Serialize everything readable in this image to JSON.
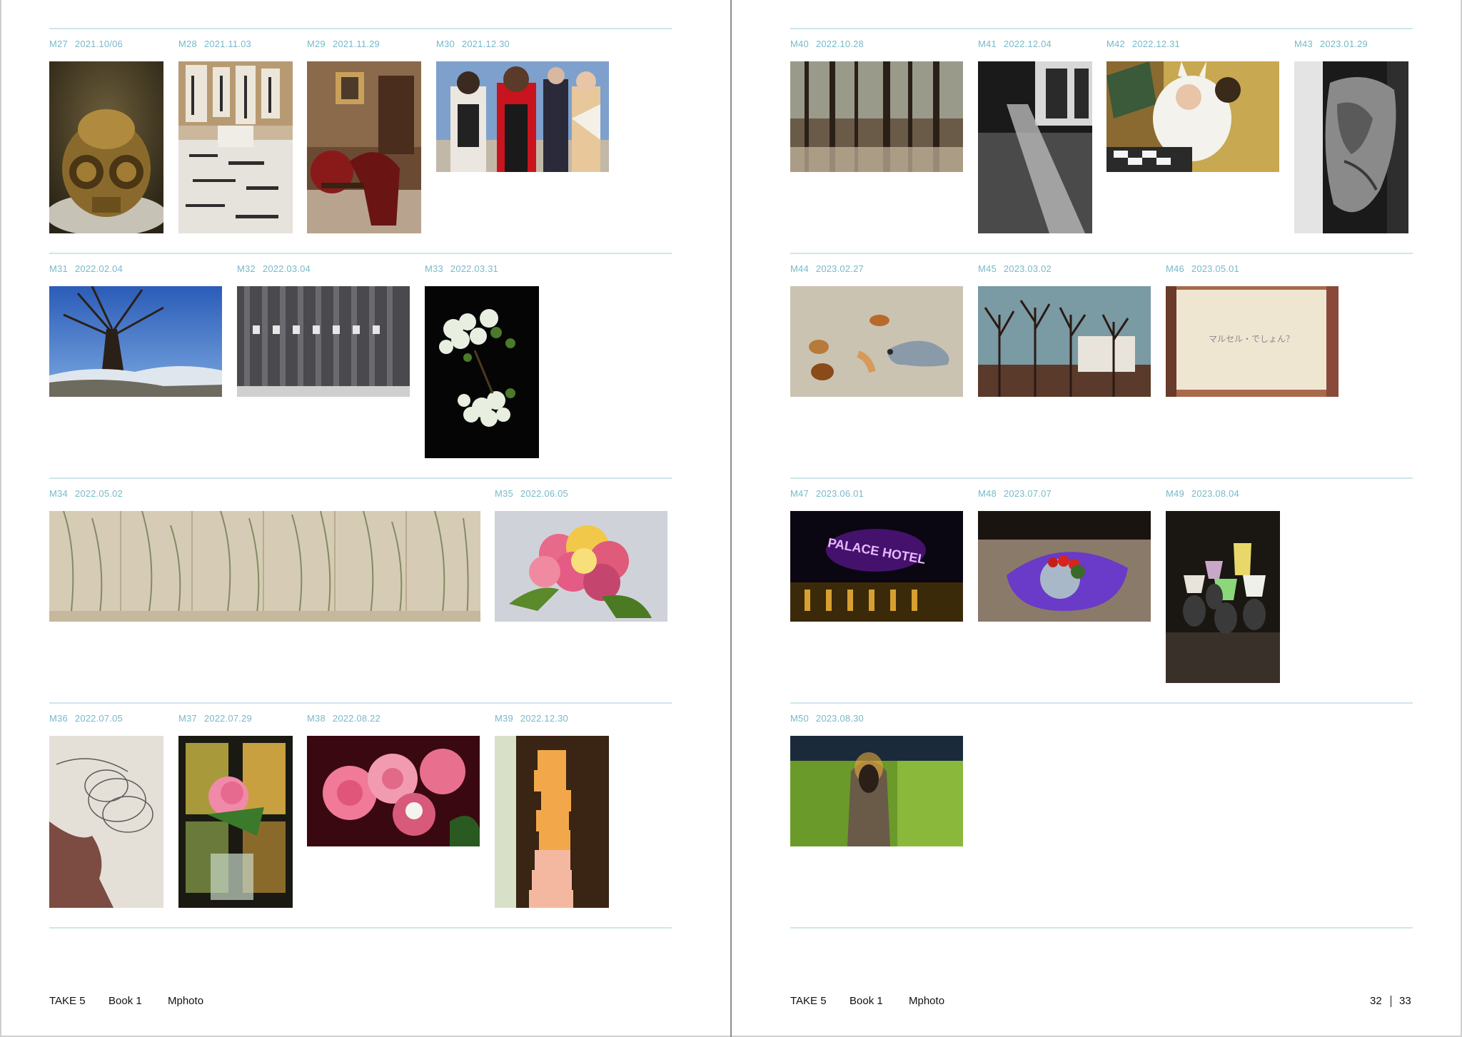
{
  "left_page": {
    "captions": [
      {
        "code": "M27",
        "date": "2021.10/06"
      },
      {
        "code": "M28",
        "date": "2021.11.03"
      },
      {
        "code": "M29",
        "date": "2021.11.29"
      },
      {
        "code": "M30",
        "date": "2021.12.30"
      },
      {
        "code": "M31",
        "date": "2022.02.04"
      },
      {
        "code": "M32",
        "date": "2022.03.04"
      },
      {
        "code": "M33",
        "date": "2022.03.31"
      },
      {
        "code": "M34",
        "date": "2022.05.02"
      },
      {
        "code": "M35",
        "date": "2022.06.05"
      },
      {
        "code": "M36",
        "date": "2022.07.05"
      },
      {
        "code": "M37",
        "date": "2022.07.29"
      },
      {
        "code": "M38",
        "date": "2022.08.22"
      },
      {
        "code": "M39",
        "date": "2022.12.30"
      }
    ],
    "footer": {
      "series": "TAKE 5",
      "book": "Book 1",
      "section": "Mphoto"
    }
  },
  "right_page": {
    "captions": [
      {
        "code": "M40",
        "date": "2022.10.28"
      },
      {
        "code": "M41",
        "date": "2022.12.04"
      },
      {
        "code": "M42",
        "date": "2022.12.31"
      },
      {
        "code": "M43",
        "date": "2023.01.29"
      },
      {
        "code": "M44",
        "date": "2023.02.27"
      },
      {
        "code": "M45",
        "date": "2023.03.02"
      },
      {
        "code": "M46",
        "date": "2023.05.01"
      },
      {
        "code": "M47",
        "date": "2023.06.01"
      },
      {
        "code": "M48",
        "date": "2023.07.07"
      },
      {
        "code": "M49",
        "date": "2023.08.04"
      },
      {
        "code": "M50",
        "date": "2023.08.30"
      }
    ],
    "footer": {
      "series": "TAKE 5",
      "book": "Book 1",
      "section": "Mphoto"
    },
    "page_numbers": {
      "left": "32",
      "right": "33"
    }
  },
  "photo_text": {
    "neon_sign": "PALACE HOTEL",
    "card_text": "マルセル・でしょん？"
  },
  "colors": {
    "caption": "#78b9c8",
    "rule": "#cfe6ea",
    "footer_text": "#111111"
  }
}
